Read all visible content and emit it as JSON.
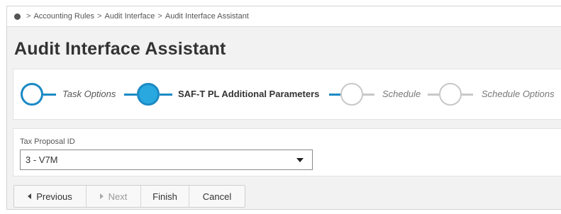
{
  "breadcrumb": {
    "items": [
      "Accounting Rules",
      "Audit Interface",
      "Audit Interface Assistant"
    ],
    "separator": ">"
  },
  "page": {
    "title": "Audit Interface Assistant"
  },
  "wizard": {
    "steps": [
      {
        "label": "Task Options",
        "state": "completed"
      },
      {
        "label": "SAF-T PL Additional Parameters",
        "state": "current"
      },
      {
        "label": "Schedule",
        "state": "pending"
      },
      {
        "label": "Schedule Options",
        "state": "pending"
      }
    ],
    "colors": {
      "active": "#1b8ac4",
      "active_fill": "#29a8e0",
      "inactive": "#c8c8c8"
    }
  },
  "form": {
    "tax_proposal": {
      "label": "Tax Proposal ID",
      "value": "3 - V7M"
    }
  },
  "buttons": {
    "previous": "Previous",
    "next": "Next",
    "finish": "Finish",
    "cancel": "Cancel"
  }
}
